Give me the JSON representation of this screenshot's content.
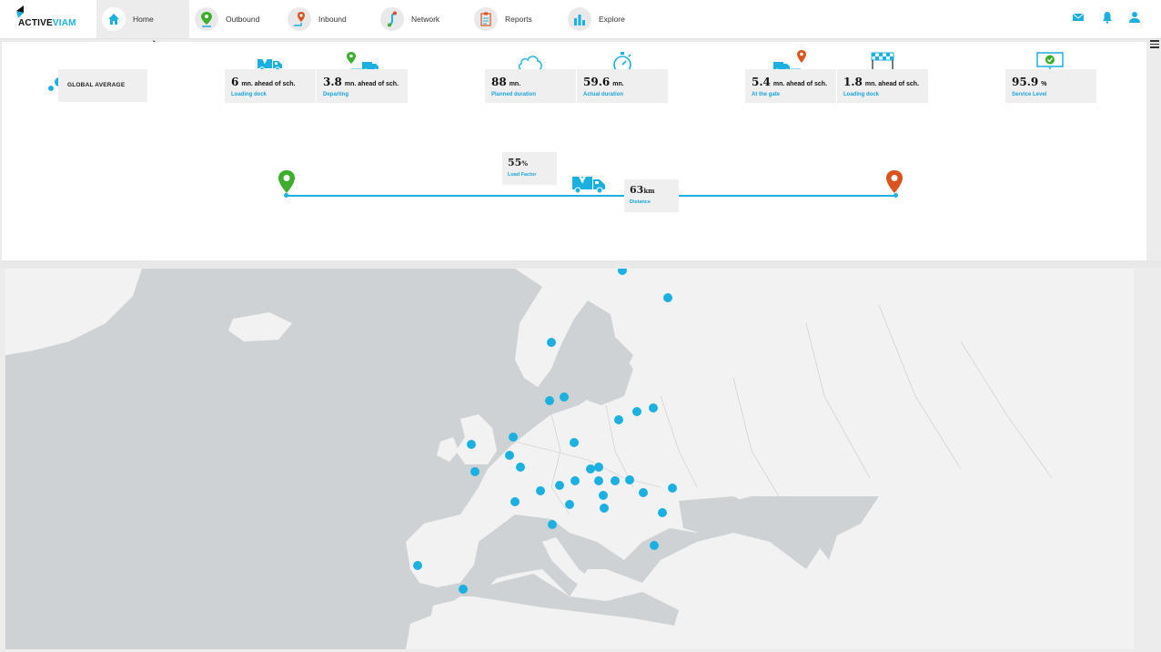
{
  "brand": {
    "name_part1": "ACTIVE",
    "name_part2": "VIAM"
  },
  "nav": [
    {
      "label": "Home",
      "icon": "home-icon",
      "active": true
    },
    {
      "label": "Outbound",
      "icon": "outbound-pin-icon"
    },
    {
      "label": "Inbound",
      "icon": "inbound-pin-icon"
    },
    {
      "label": "Network",
      "icon": "network-icon"
    },
    {
      "label": "Reports",
      "icon": "reports-icon"
    },
    {
      "label": "Explore",
      "icon": "bar-chart-icon"
    }
  ],
  "top_right": {
    "icons": [
      "mail-icon",
      "bell-icon",
      "user-icon"
    ]
  },
  "global_average": {
    "label": "GLOBAL AVERAGE"
  },
  "kpis": [
    {
      "value": "6",
      "unit": "mn. ahead of sch.",
      "label": "Loading dock",
      "icon": "truck-loading-icon"
    },
    {
      "value": "3.8",
      "unit": "mn. ahead of sch.",
      "label": "Departing",
      "icon": "truck-departing-icon"
    },
    {
      "value": "88",
      "unit": "mn.",
      "label": "Planned duration",
      "icon": "cloud-icon"
    },
    {
      "value": "59.6",
      "unit": "mn.",
      "label": "Actual duration",
      "icon": "stopwatch-icon"
    },
    {
      "value": "5.4",
      "unit": "mn. ahead of sch.",
      "label": "At the gate",
      "icon": "truck-arrival-icon"
    },
    {
      "value": "1.8",
      "unit": "mn. ahead of sch.",
      "label": "Loading dock",
      "icon": "checkered-flag-icon"
    },
    {
      "value": "95.9",
      "unit": "%",
      "label": "Service Level",
      "icon": "monitor-check-icon"
    }
  ],
  "route": {
    "load_factor": {
      "value": "55",
      "unit": "%",
      "label": "Load Factor"
    },
    "distance": {
      "value": "63",
      "unit": "km",
      "label": "Distance"
    },
    "colors": {
      "line": "#1cb0e0",
      "origin": "#3dae2b",
      "destination": "#d9541e"
    }
  },
  "map": {
    "marker_color": "#1cb0e0",
    "land_color": "#f2f2f2",
    "water_color": "#cfd2d4"
  }
}
